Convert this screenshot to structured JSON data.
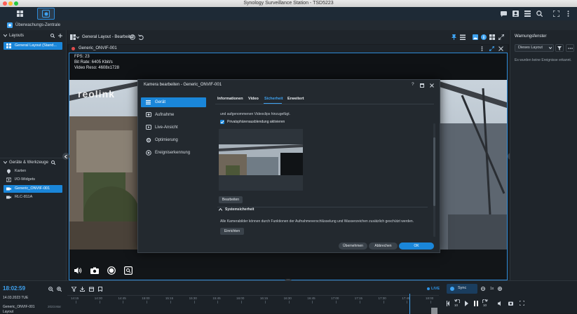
{
  "window": {
    "title": "Synology Surveillance Station - TSD5223"
  },
  "subbar": {
    "label": "Überwachungs-Zentrale"
  },
  "left_panel": {
    "layouts_title": "Layouts",
    "layout_item": "General Layout (Stand...",
    "devices_title": "Geräte & Werkzeuge",
    "device_items": [
      "Karten",
      "I/O-Widgets",
      "Generic_ONVIF-001",
      "RLC-811A"
    ]
  },
  "center": {
    "layout_title": "General Layout - Bearbeitet",
    "camera_name": "Generic_ONVIF-001",
    "overlay": {
      "fps": "FPS: 23",
      "bitrate": "Bit Rate: 6405 Kbit/s",
      "resolution": "Video Reso: 4608x1728"
    },
    "logo": "reolink"
  },
  "right_panel": {
    "title": "Warnungsfenster",
    "filter": "Dieses Layout",
    "message": "Es wurden keine Ereignisse erkannt."
  },
  "dialog": {
    "title": "Kamera bearbeiten - Generic_ONVIF-001",
    "nav": [
      "Gerät",
      "Aufnahme",
      "Live-Ansicht",
      "Optimierung",
      "Ereigniserkennung"
    ],
    "tabs": [
      "Informationen",
      "Video",
      "Sicherheit",
      "Erweitert"
    ],
    "active_tab": "Sicherheit",
    "intro_text": "und aufgenommenen Videoclips hinzugefügt.",
    "privacy_checkbox": "Privatsphärenausblendung aktivieren",
    "edit_button": "Bearbeiten",
    "system_security_title": "Systemsicherheit",
    "system_security_text": "Alle Kamerabilder können durch Funktionen der Aufnahmeverschlüsselung und Wasserzeichen zusätzlich geschützt werden.",
    "setup_button": "Einrichten",
    "apply_button": "Übernehmen",
    "cancel_button": "Abbrechen",
    "ok_button": "OK",
    "help_glyph": "?"
  },
  "timeline": {
    "clock": "18:02:59",
    "date": "14.03.2023 TUE",
    "layout_label": "Layout",
    "camera_row": "Generic_ONVIF-001",
    "camera_row_date": "2023.Mar",
    "live": "LIVE",
    "sync": "Sync",
    "speed": "1x",
    "ticks": [
      "14:15",
      "14:30",
      "14:45",
      "15:00",
      "15:15",
      "15:30",
      "15:45",
      "16:00",
      "16:15",
      "16:30",
      "16:45",
      "17:00",
      "17:15",
      "17:30",
      "17:45",
      "18:00"
    ],
    "skip_back": "10",
    "skip_fwd": "10"
  },
  "colors": {
    "accent": "#1a86d9",
    "live": "#2d93e6",
    "bg": "#1a1d21"
  }
}
